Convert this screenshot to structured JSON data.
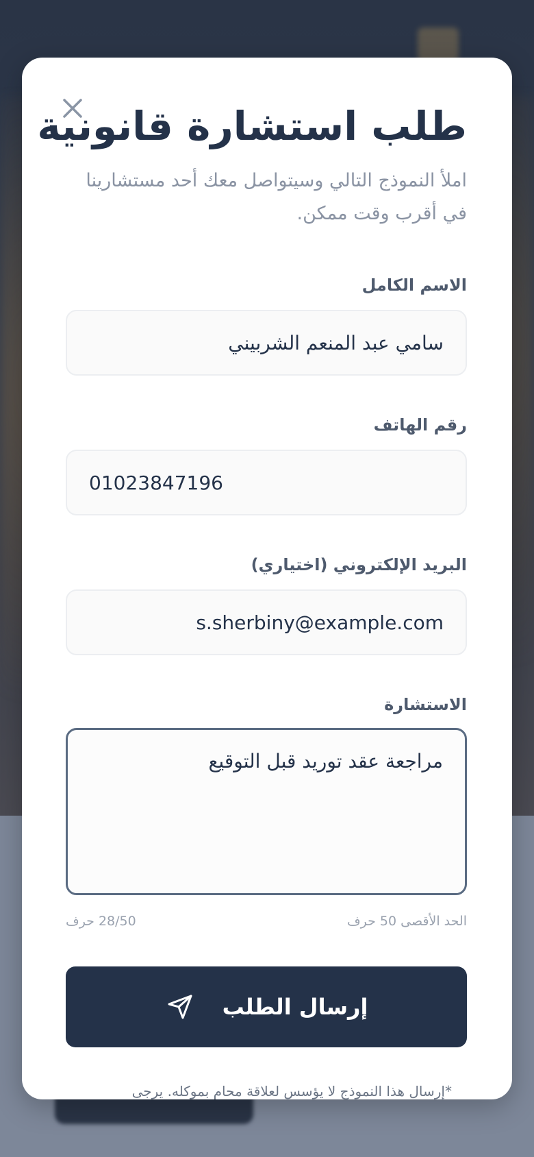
{
  "modal": {
    "title": "طلب استشارة قانونية",
    "subtitle": "املأ النموذج التالي وسيتواصل معك أحد مستشارينا في أقرب وقت ممكن.",
    "close_icon": "close-icon"
  },
  "form": {
    "name": {
      "label": "الاسم الكامل",
      "value": "سامي عبد المنعم الشربيني"
    },
    "phone": {
      "label": "رقم الهاتف",
      "value": "01023847196"
    },
    "email": {
      "label": "البريد الإلكتروني (اختياري)",
      "value": "s.sherbiny@example.com"
    },
    "consultation": {
      "label": "الاستشارة",
      "value": "مراجعة عقد توريد قبل التوقيع",
      "counter": "28/50 حرف",
      "max_hint": "الحد الأقصى 50 حرف"
    },
    "submit": {
      "label": "إرسال الطلب",
      "icon": "send-icon"
    },
    "disclaimer": "*إرسال هذا النموذج لا يؤسس لعلاقة محام بموكله. يرجى"
  },
  "colors": {
    "primary": "#243249",
    "text_muted": "#8a93a3",
    "field_bg": "#fafafa",
    "focus_border": "#5a6b82"
  }
}
